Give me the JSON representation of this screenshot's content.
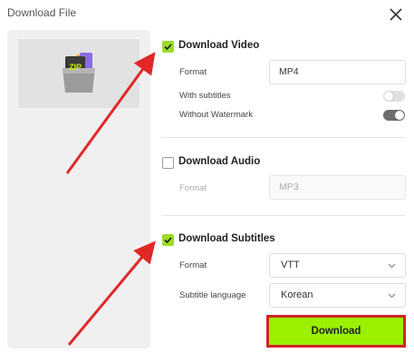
{
  "dialog": {
    "title": "Download File"
  },
  "video": {
    "title": "Download Video",
    "checked": true,
    "format_label": "Format",
    "format_value": "MP4",
    "subtitles_label": "With subtitles",
    "subtitles_on": false,
    "watermark_label": "Without Watermark",
    "watermark_on": true
  },
  "audio": {
    "title": "Download Audio",
    "checked": false,
    "format_label": "Format",
    "format_value": "MP3"
  },
  "subtitles": {
    "title": "Download Subtitles",
    "checked": true,
    "format_label": "Format",
    "format_value": "VTT",
    "language_label": "Subtitle language",
    "language_value": "Korean"
  },
  "thumbnail": {
    "icon_text": "ZIP"
  },
  "actions": {
    "download_label": "Download"
  },
  "colors": {
    "accent": "#9bdc28",
    "button_fill": "#9bf000",
    "highlight_border": "#d32323",
    "arrow": "#e02828"
  }
}
